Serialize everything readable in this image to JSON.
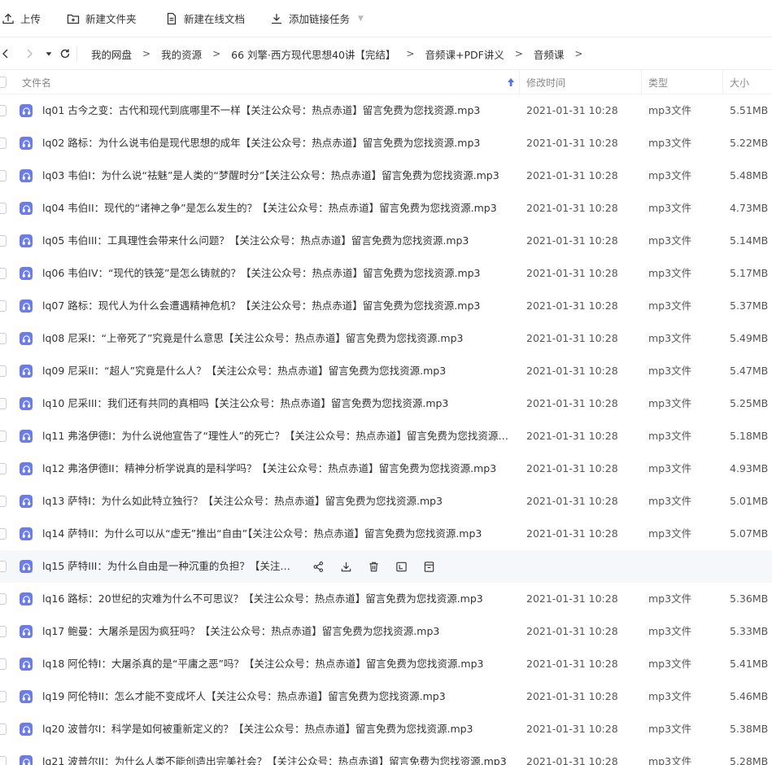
{
  "toolbar": {
    "upload": "上传",
    "new_folder": "新建文件夹",
    "new_doc": "新建在线文档",
    "add_link_task": "添加链接任务"
  },
  "breadcrumb": [
    "我的网盘",
    "我的资源",
    "66 刘擎·西方现代思想40讲【完结】",
    "音频课+PDF讲义",
    "音频课"
  ],
  "breadcrumb_separator": ">",
  "columns": {
    "name": "文件名",
    "modified": "修改时间",
    "type": "类型",
    "size": "大小"
  },
  "files": [
    {
      "name": "lq01 古今之变：古代和现代到底哪里不一样【关注公众号：热点赤道】留言免费为您找资源.mp3",
      "date": "2021-01-31 10:28",
      "type": "mp3文件",
      "size": "5.51MB"
    },
    {
      "name": "lq02 路标：为什么说韦伯是现代思想的成年【关注公众号：热点赤道】留言免费为您找资源.mp3",
      "date": "2021-01-31 10:28",
      "type": "mp3文件",
      "size": "5.22MB"
    },
    {
      "name": "lq03 韦伯I：为什么说“祛魅”是人类的“梦醒时分”【关注公众号：热点赤道】留言免费为您找资源.mp3",
      "date": "2021-01-31 10:28",
      "type": "mp3文件",
      "size": "5.48MB"
    },
    {
      "name": "lq04 韦伯II：现代的“诸神之争”是怎么发生的？【关注公众号：热点赤道】留言免费为您找资源.mp3",
      "date": "2021-01-31 10:28",
      "type": "mp3文件",
      "size": "4.73MB"
    },
    {
      "name": "lq05 韦伯III：工具理性会带来什么问题？【关注公众号：热点赤道】留言免费为您找资源.mp3",
      "date": "2021-01-31 10:28",
      "type": "mp3文件",
      "size": "5.14MB"
    },
    {
      "name": "lq06 韦伯IV：“现代的铁笼”是怎么铸就的？【关注公众号：热点赤道】留言免费为您找资源.mp3",
      "date": "2021-01-31 10:28",
      "type": "mp3文件",
      "size": "5.17MB"
    },
    {
      "name": "lq07 路标：现代人为什么会遭遇精神危机？【关注公众号：热点赤道】留言免费为您找资源.mp3",
      "date": "2021-01-31 10:28",
      "type": "mp3文件",
      "size": "5.37MB"
    },
    {
      "name": "lq08 尼采I：“上帝死了”究竟是什么意思【关注公众号：热点赤道】留言免费为您找资源.mp3",
      "date": "2021-01-31 10:28",
      "type": "mp3文件",
      "size": "5.49MB"
    },
    {
      "name": "lq09 尼采II：“超人”究竟是什么人？【关注公众号：热点赤道】留言免费为您找资源.mp3",
      "date": "2021-01-31 10:28",
      "type": "mp3文件",
      "size": "5.47MB"
    },
    {
      "name": "lq10 尼采III：我们还有共同的真相吗【关注公众号：热点赤道】留言免费为您找资源.mp3",
      "date": "2021-01-31 10:28",
      "type": "mp3文件",
      "size": "5.25MB"
    },
    {
      "name": "lq11 弗洛伊德I：为什么说他宣告了“理性人”的死亡？【关注公众号：热点赤道】留言免费为您找资源.m…",
      "date": "2021-01-31 10:28",
      "type": "mp3文件",
      "size": "5.18MB"
    },
    {
      "name": "lq12 弗洛伊德II：精神分析学说真的是科学吗？【关注公众号：热点赤道】留言免费为您找资源.mp3",
      "date": "2021-01-31 10:28",
      "type": "mp3文件",
      "size": "4.93MB"
    },
    {
      "name": "lq13 萨特I：为什么如此特立独行？【关注公众号：热点赤道】留言免费为您找资源.mp3",
      "date": "2021-01-31 10:28",
      "type": "mp3文件",
      "size": "5.01MB"
    },
    {
      "name": "lq14 萨特II：为什么可以从“虚无”推出“自由”【关注公众号：热点赤道】留言免费为您找资源.mp3",
      "date": "2021-01-31 10:28",
      "type": "mp3文件",
      "size": "5.07MB"
    },
    {
      "name": "lq15 萨特III：为什么自由是一种沉重的负担？【关注公…",
      "date": "",
      "type": "",
      "size": "",
      "hover": true
    },
    {
      "name": "lq16 路标：20世纪的灾难为什么不可思议？【关注公众号：热点赤道】留言免费为您找资源.mp3",
      "date": "2021-01-31 10:28",
      "type": "mp3文件",
      "size": "5.36MB"
    },
    {
      "name": "lq17 鲍曼：大屠杀是因为疯狂吗？【关注公众号：热点赤道】留言免费为您找资源.mp3",
      "date": "2021-01-31 10:28",
      "type": "mp3文件",
      "size": "5.33MB"
    },
    {
      "name": "lq18 阿伦特I：大屠杀真的是“平庸之恶”吗？【关注公众号：热点赤道】留言免费为您找资源.mp3",
      "date": "2021-01-31 10:28",
      "type": "mp3文件",
      "size": "5.41MB"
    },
    {
      "name": "lq19 阿伦特II：怎么才能不变成坏人【关注公众号：热点赤道】留言免费为您找资源.mp3",
      "date": "2021-01-31 10:28",
      "type": "mp3文件",
      "size": "5.46MB"
    },
    {
      "name": "lq20 波普尔I：科学是如何被重新定义的？【关注公众号：热点赤道】留言免费为您找资源.mp3",
      "date": "2021-01-31 10:28",
      "type": "mp3文件",
      "size": "5.38MB"
    },
    {
      "name": "lq21 波普尔II：为什么人类不能创造出完美社会？【关注公众号：热点赤道】留言免费为您找资源.mp3",
      "date": "2021-01-31 10:28",
      "type": "mp3文件",
      "size": "5.28MB"
    }
  ],
  "hover_actions": [
    "share-icon",
    "download-icon",
    "delete-icon",
    "rename-icon",
    "more-icon"
  ],
  "colors": {
    "accent": "#4f6df5",
    "file_icon": "#6a7cf0",
    "hover_row": "#f6f7fb"
  }
}
